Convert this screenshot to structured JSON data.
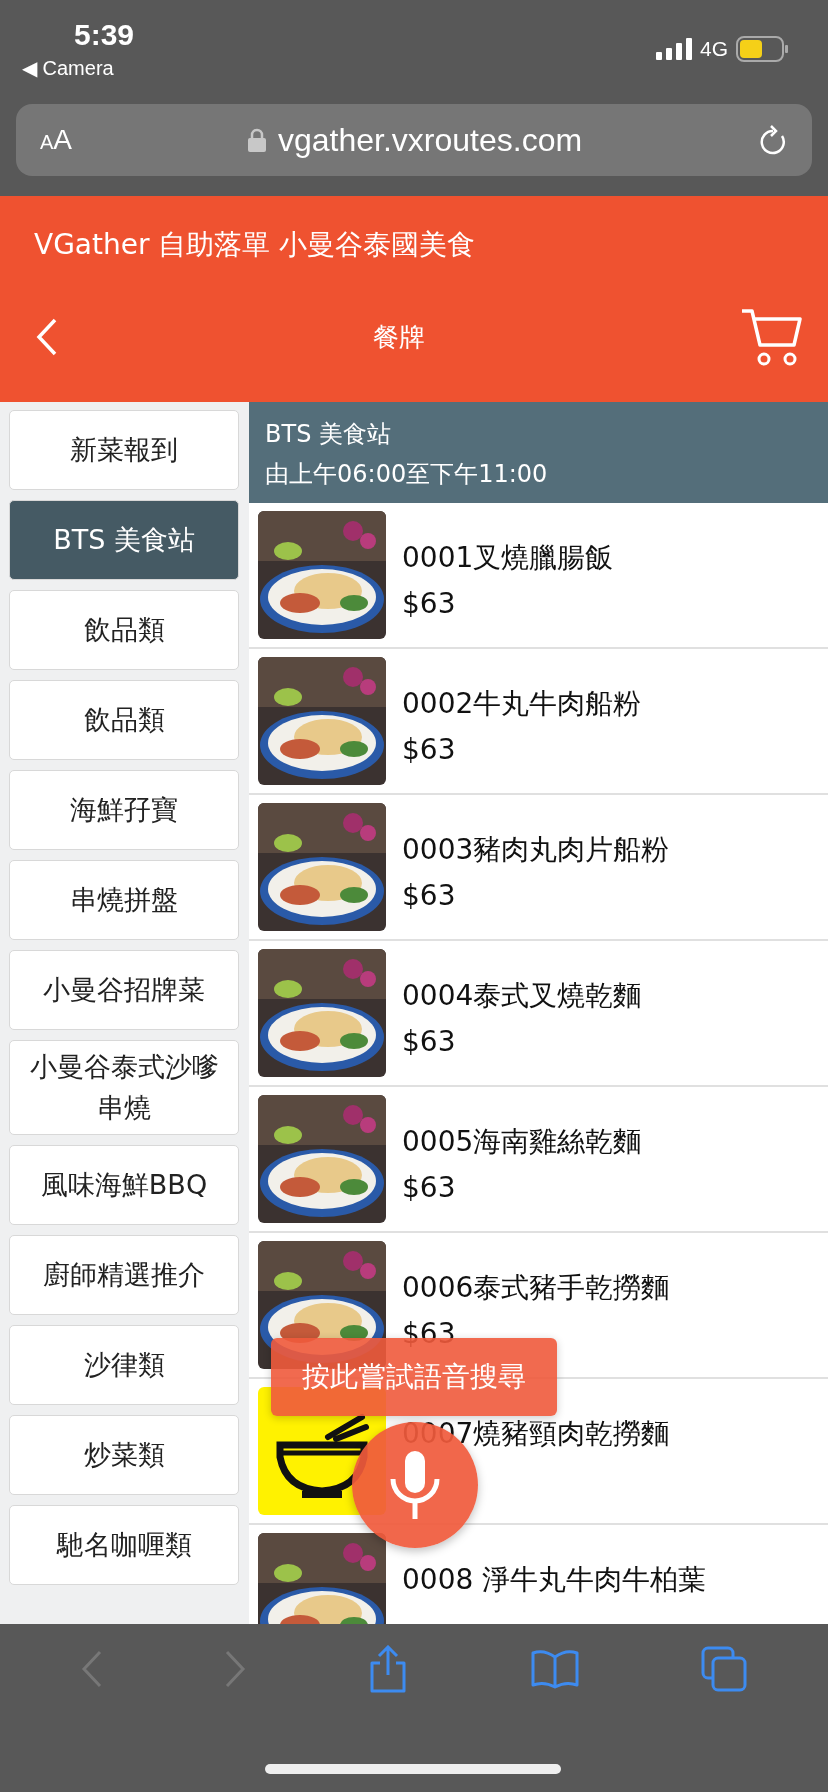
{
  "status_bar": {
    "time": "5:39",
    "back_app": "◀ Camera",
    "network": "4G"
  },
  "browser": {
    "text_size": "AA",
    "url": "vgather.vxroutes.com"
  },
  "header": {
    "title": "VGather 自助落單 小曼谷泰國美食",
    "nav_title": "餐牌"
  },
  "categories": [
    {
      "label": "新菜報到",
      "selected": false
    },
    {
      "label": "BTS 美食站",
      "selected": true
    },
    {
      "label": "飲品類",
      "selected": false
    },
    {
      "label": "飲品類",
      "selected": false
    },
    {
      "label": "海鮮孖寶",
      "selected": false
    },
    {
      "label": "串燒拼盤",
      "selected": false
    },
    {
      "label": "小曼谷招牌菜",
      "selected": false
    },
    {
      "label": "小曼谷泰式沙嗲串燒",
      "selected": false
    },
    {
      "label": "風味海鮮BBQ",
      "selected": false
    },
    {
      "label": "廚師精選推介",
      "selected": false
    },
    {
      "label": "沙律類",
      "selected": false
    },
    {
      "label": "炒菜類",
      "selected": false
    },
    {
      "label": "馳名咖喱類",
      "selected": false
    }
  ],
  "store": {
    "name": "BTS 美食站",
    "hours": "由上午06:00至下午11:00"
  },
  "items": [
    {
      "name": "0001叉燒臘腸飯",
      "price": "$63"
    },
    {
      "name": "0002牛丸牛肉船粉",
      "price": "$63"
    },
    {
      "name": "0003豬肉丸肉片船粉",
      "price": "$63"
    },
    {
      "name": "0004泰式叉燒乾麵",
      "price": "$63"
    },
    {
      "name": "0005海南雞絲乾麵",
      "price": "$63"
    },
    {
      "name": "0006泰式豬手乾撈麵",
      "price": "$63"
    },
    {
      "name": "0007燒豬頸肉乾撈麵",
      "kind": "placeholder"
    },
    {
      "name": "0008 淨牛丸牛肉牛柏葉"
    }
  ],
  "voice_search": {
    "tooltip": "按此嘗試語音搜尋"
  }
}
